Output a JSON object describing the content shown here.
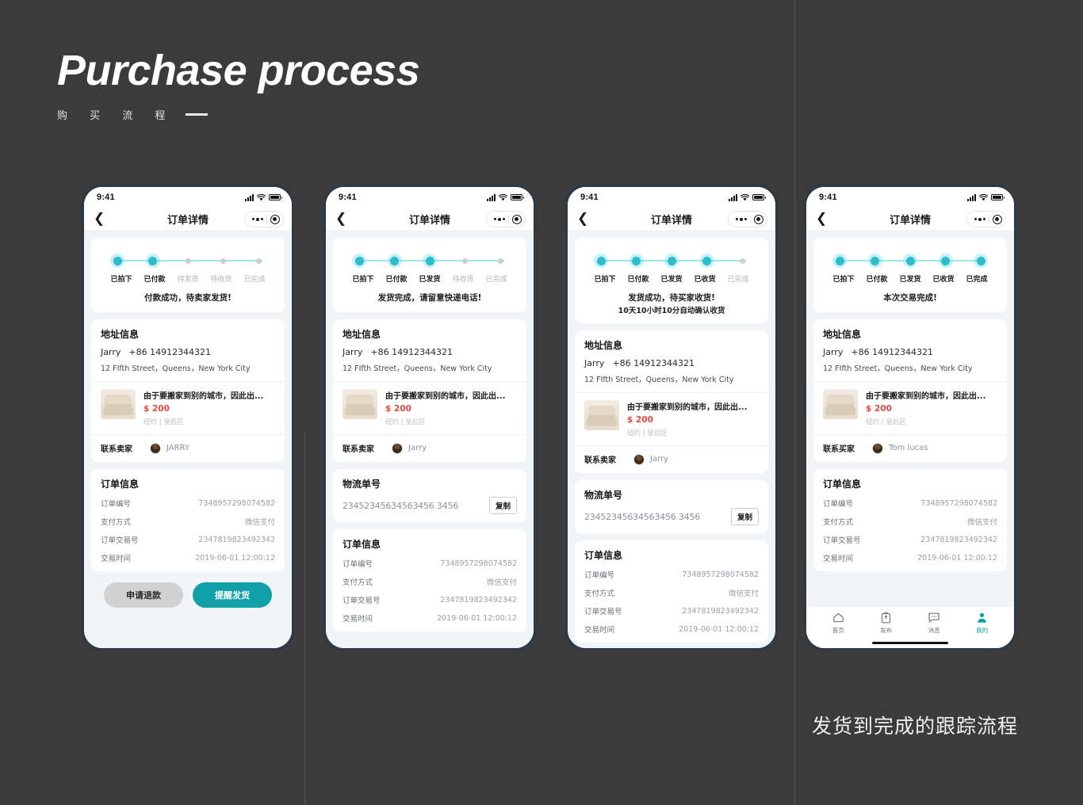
{
  "header": {
    "title": "Purchase process",
    "subtitle": "购 买 流 程"
  },
  "caption": "发货到完成的跟踪流程",
  "common": {
    "status_time": "9:41",
    "nav_title": "订单详情",
    "back_icon": "chevron-left-icon",
    "address": {
      "card_title": "地址信息",
      "name": "Jarry",
      "phone": "+86 14912344321",
      "street": "12 FIfth Street，Queens，New York City"
    },
    "product": {
      "title": "由于要搬家到别的城市，因此出...",
      "price": "$ 200",
      "location": "纽约 | 皇后区"
    },
    "order": {
      "card_title": "订单信息",
      "rows": [
        {
          "key": "订单编号",
          "value": "7348957298074582"
        },
        {
          "key": "支付方式",
          "value": "微信支付"
        },
        {
          "key": "订单交易号",
          "value": "2347819823492342"
        },
        {
          "key": "交易时间",
          "value": "2019-06-01 12:00:12"
        }
      ]
    },
    "logistics": {
      "card_title": "物流单号",
      "number": "23452345634563456 3456",
      "copy_label": "复制"
    },
    "steps": [
      "已拍下",
      "已付款",
      "待发货",
      "待收货",
      "已完成"
    ],
    "steps_shipped": [
      "已拍下",
      "已付款",
      "已发货",
      "待收货",
      "已完成"
    ],
    "steps_received": [
      "已拍下",
      "已付款",
      "已发货",
      "已收货",
      "已完成"
    ]
  },
  "colors": {
    "accent_teal": "#12a0a8",
    "dot_active": "#12a7b5",
    "track": "#9ee7f0",
    "price_red": "#e8483f",
    "page_bg": "#3b3b3b",
    "screen_bg": "#f2f5f7"
  },
  "phones": [
    {
      "id": "phone-1",
      "active_steps": 2,
      "step_labels": [
        "已拍下",
        "已付款",
        "待发货",
        "待收货",
        "已完成"
      ],
      "status_msg": "付款成功，待卖家发货!",
      "status_sub": "",
      "contact_label": "联系卖家",
      "contact_name": "JARRY",
      "has_logistics": false,
      "has_actions": true,
      "has_tabbar": false,
      "actions": {
        "secondary": "申请退款",
        "primary": "提醒发货"
      }
    },
    {
      "id": "phone-2",
      "active_steps": 3,
      "step_labels": [
        "已拍下",
        "已付款",
        "已发货",
        "待收货",
        "已完成"
      ],
      "status_msg": "发货完成，请留意快递电话!",
      "status_sub": "",
      "contact_label": "联系卖家",
      "contact_name": "Jarry",
      "has_logistics": true,
      "has_actions": false,
      "has_tabbar": false,
      "actions": null
    },
    {
      "id": "phone-3",
      "active_steps": 4,
      "step_labels": [
        "已拍下",
        "已付款",
        "已发货",
        "已收货",
        "已完成"
      ],
      "status_msg": "发货成功，待买家收货!",
      "status_sub": "10天10小时10分自动确认收货",
      "contact_label": "联系卖家",
      "contact_name": "Jarry",
      "has_logistics": true,
      "has_actions": false,
      "has_tabbar": false,
      "actions": null
    },
    {
      "id": "phone-4",
      "active_steps": 5,
      "step_labels": [
        "已拍下",
        "已付款",
        "已发货",
        "已收货",
        "已完成"
      ],
      "status_msg": "本次交易完成!",
      "status_sub": "",
      "contact_label": "联系买家",
      "contact_name": "Tom lucas",
      "has_logistics": false,
      "has_actions": false,
      "has_tabbar": true,
      "actions": null
    }
  ],
  "tabbar": {
    "items": [
      {
        "label": "首页",
        "icon": "home-icon",
        "active": false
      },
      {
        "label": "发布",
        "icon": "publish-clipboard-icon",
        "active": false
      },
      {
        "label": "消息",
        "icon": "message-bubble-icon",
        "active": false
      },
      {
        "label": "我的",
        "icon": "profile-person-icon",
        "active": true
      }
    ]
  }
}
